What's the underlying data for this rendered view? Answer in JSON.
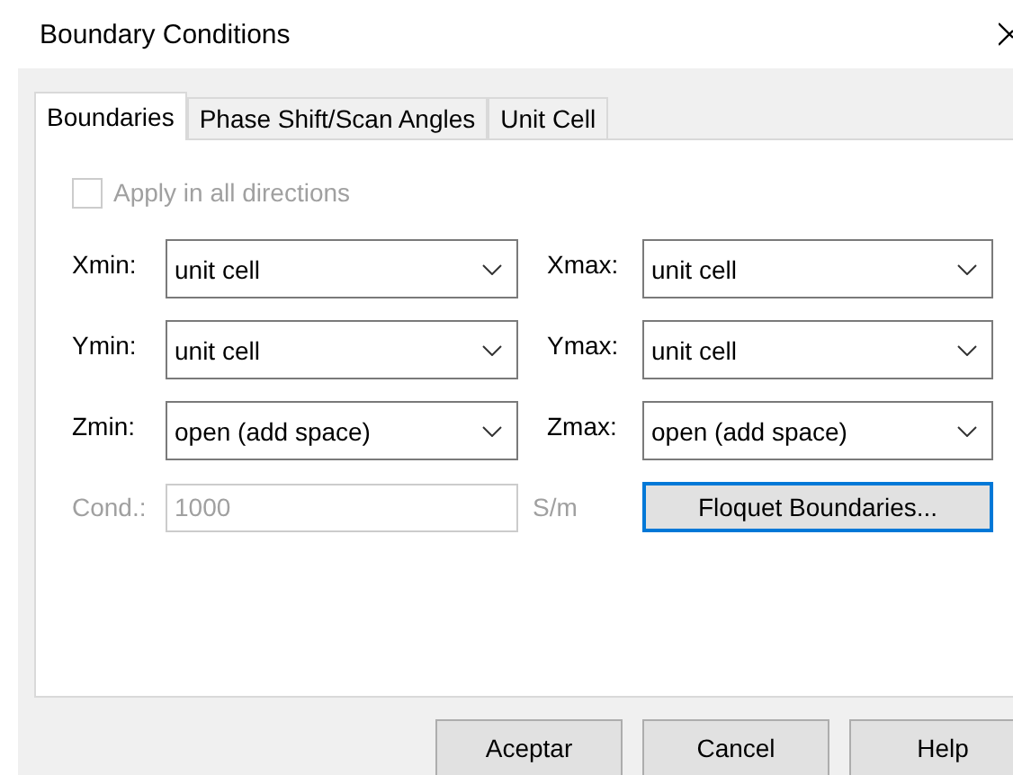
{
  "window": {
    "title": "Boundary Conditions"
  },
  "tabs": [
    {
      "label": "Boundaries",
      "selected": true
    },
    {
      "label": "Phase Shift/Scan Angles",
      "selected": false
    },
    {
      "label": "Unit Cell",
      "selected": false
    }
  ],
  "apply_all": {
    "label": "Apply in all directions",
    "checked": false,
    "disabled": true
  },
  "boundaries": [
    {
      "label": "Xmin:",
      "value": "unit cell"
    },
    {
      "label": "Xmax:",
      "value": "unit cell"
    },
    {
      "label": "Ymin:",
      "value": "unit cell"
    },
    {
      "label": "Ymax:",
      "value": "unit cell"
    },
    {
      "label": "Zmin:",
      "value": "open (add space)"
    },
    {
      "label": "Zmax:",
      "value": "open (add space)"
    }
  ],
  "conductivity": {
    "label": "Cond.:",
    "value": "1000",
    "unit": "S/m",
    "disabled": true
  },
  "floquet_button": {
    "label": "Floquet Boundaries...",
    "focused": true
  },
  "buttons": [
    "Aceptar",
    "Cancel",
    "Help"
  ]
}
